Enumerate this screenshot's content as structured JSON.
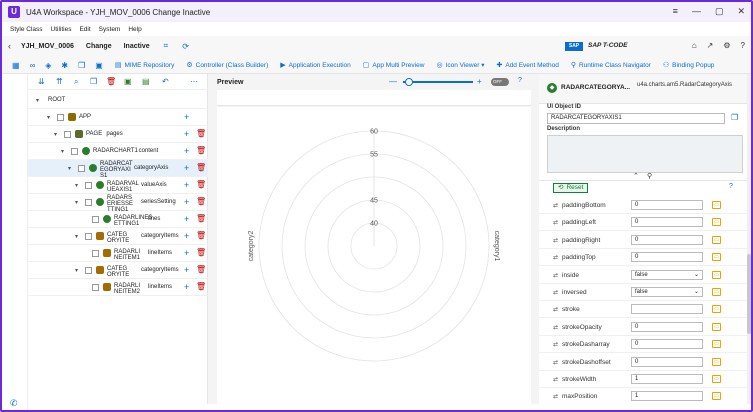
{
  "window": {
    "logo": "U",
    "title": "U4A Workspace - YJH_MOV_0006 Change Inactive",
    "controls": {
      "menu": "≡",
      "minimize": "—",
      "maximize": "▢",
      "close": "✕"
    }
  },
  "menu": [
    "Style Class",
    "Utilities",
    "Edit",
    "System",
    "Help"
  ],
  "header": {
    "back": "‹",
    "app_name": "YJH_MOV_0006",
    "mode": "Change",
    "state": "Inactive",
    "sap_logo": "SAP",
    "system": "SAP T-CODE",
    "right_icons": [
      "⌂",
      "↗",
      "⚙",
      "?"
    ]
  },
  "toolbar": {
    "items": [
      {
        "icon": "⚙",
        "label": "MIME Repository"
      },
      {
        "icon": "⚙",
        "label": "Controller (Class Builder)"
      },
      {
        "icon": "⚙",
        "label": "Application Execution"
      },
      {
        "icon": "⚙",
        "label": "App Multi Preview"
      },
      {
        "icon": "⚙",
        "label": "Icon Viewer ▾"
      },
      {
        "icon": "⚙",
        "label": "Add Event Method"
      },
      {
        "icon": "⚙",
        "label": "Runtime Class Navigator"
      },
      {
        "icon": "⚙",
        "label": "Binding Popup"
      }
    ]
  },
  "tree": {
    "rows": [
      {
        "label": "ROOT",
        "agg": "",
        "icon": "",
        "color": "",
        "level": 0,
        "selected": false,
        "has_actions": false
      },
      {
        "label": "APP",
        "agg": "",
        "icon": "app",
        "color": "#8a6d00",
        "level": 1,
        "selected": false,
        "has_actions": true,
        "no_delete": true
      },
      {
        "label": "PAGE",
        "agg": "pages",
        "icon": "page",
        "color": "#5b6b2d",
        "level": 2,
        "selected": false,
        "has_actions": true
      },
      {
        "label": "RADARCHART1",
        "agg": "content",
        "icon": "chart",
        "color": "#2b7d2b",
        "level": 3,
        "selected": false,
        "has_actions": true
      },
      {
        "label": "RADARCAT EGORYAXI S1",
        "agg": "categoryAxis",
        "icon": "chart",
        "color": "#2b7d2b",
        "level": 4,
        "selected": true,
        "has_actions": true
      },
      {
        "label": "RADARVAL UEAXIS1",
        "agg": "valueAxis",
        "icon": "chart",
        "color": "#2b7d2b",
        "level": 5,
        "selected": false,
        "has_actions": true
      },
      {
        "label": "RADARS ERIESSE TTING1",
        "agg": "seriesSetting",
        "icon": "chart",
        "color": "#2b7d2b",
        "level": 5,
        "selected": false,
        "has_actions": true
      },
      {
        "label": "RADARLINES ETTING1",
        "agg": "lines",
        "icon": "chart",
        "color": "#2b7d2b",
        "level": 6,
        "selected": false,
        "has_actions": true
      },
      {
        "label": "CATEG ORYITE",
        "agg": "categoryItems",
        "icon": "item",
        "color": "#a36b00",
        "level": 5,
        "selected": false,
        "has_actions": true
      },
      {
        "label": "RADARLI NEITEM1",
        "agg": "lineItems",
        "icon": "item",
        "color": "#a36b00",
        "level": 6,
        "selected": false,
        "has_actions": true
      },
      {
        "label": "CATEG ORYITE",
        "agg": "categoryItems",
        "icon": "item",
        "color": "#a36b00",
        "level": 5,
        "selected": false,
        "has_actions": true
      },
      {
        "label": "RADARLI NEITEM2",
        "agg": "lineItems",
        "icon": "item",
        "color": "#a36b00",
        "level": 6,
        "selected": false,
        "has_actions": true
      }
    ]
  },
  "preview": {
    "title": "Preview",
    "toggle": "OFF",
    "zoom_minus": "—",
    "zoom_plus": "+",
    "help": "?"
  },
  "chart_data": {
    "type": "radar",
    "ticks": [
      40,
      45,
      55,
      60
    ],
    "categories": [
      "category1",
      "category2"
    ]
  },
  "props": {
    "control_name": "RADARCATEGORYA...",
    "control_type": "u4a.charts.am5.RadarCategoryAxis",
    "uid_label": "UI Object ID",
    "uid_value": "RADARCATEGORYAXIS1",
    "desc_label": "Description",
    "reset_label": "Reset",
    "help": "?",
    "rows": [
      {
        "name": "paddingBottom",
        "value": "0",
        "kind": "input"
      },
      {
        "name": "paddingLeft",
        "value": "0",
        "kind": "input"
      },
      {
        "name": "paddingRight",
        "value": "0",
        "kind": "input"
      },
      {
        "name": "paddingTop",
        "value": "0",
        "kind": "input"
      },
      {
        "name": "inside",
        "value": "false",
        "kind": "select"
      },
      {
        "name": "inversed",
        "value": "false",
        "kind": "select"
      },
      {
        "name": "stroke",
        "value": "",
        "kind": "input"
      },
      {
        "name": "strokeOpacity",
        "value": "0",
        "kind": "input"
      },
      {
        "name": "strokeDasharray",
        "value": "0",
        "kind": "input"
      },
      {
        "name": "strokeDashoffset",
        "value": "0",
        "kind": "input"
      },
      {
        "name": "strokeWidth",
        "value": "1",
        "kind": "input"
      },
      {
        "name": "maxPosition",
        "value": "1",
        "kind": "input"
      },
      {
        "name": "minPosition",
        "value": "0",
        "kind": "input"
      }
    ]
  },
  "colors": {
    "accent": "#0a6ed1",
    "frame": "#6c2bd9",
    "delete": "#bb0000",
    "selected_row": "#e5f0fa",
    "reset": "#107e3e"
  }
}
